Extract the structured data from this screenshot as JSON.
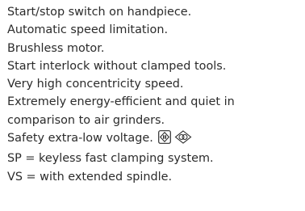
{
  "features": [
    "Start/stop switch on handpiece.",
    "Automatic speed limitation.",
    "Brushless motor.",
    "Start interlock without clamped tools.",
    "Very high concentricity speed.",
    "Extremely energy-efficient and quiet in",
    "comparison to air grinders.",
    "Safety extra-low voltage.",
    "SP = keyless fast clamping system.",
    "VS = with extended spindle."
  ],
  "symbols": {
    "safety_voltage_icon": "protection-class-iii-icon",
    "transformer_icon": "safety-transformer-icon"
  }
}
